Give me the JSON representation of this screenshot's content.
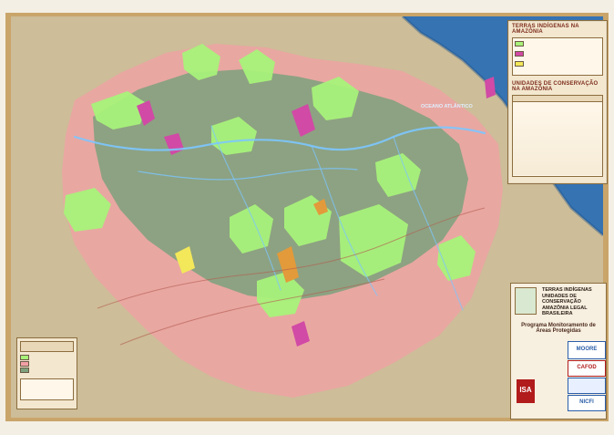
{
  "map": {
    "labels": {
      "ocean": "OCEANO ATLÂNTICO",
      "map_title_lines": [
        "TERRAS INDÍGENAS",
        "UNIDADES DE CONSERVAÇÃO",
        "AMAZÔNIA LEGAL BRASILEIRA"
      ],
      "program_title": "Programa Monitoramento de Áreas Protegidas"
    },
    "tables": {
      "indigenous_title": "TERRAS INDÍGENAS NA AMAZÔNIA",
      "conservation_title": "UNIDADES DE CONSERVAÇÃO NA AMAZÔNIA"
    },
    "logos": {
      "moore": "MOORE",
      "cafod": "CAFOD",
      "nicfi": "NICFI",
      "isa": "ISA"
    },
    "colors": {
      "ocean": "#2d6fb3",
      "indigenous_green": "#a8f27a",
      "conservation_pink": "#f2a0a6",
      "forest": "#7da17c",
      "terrain": "#cdbd98",
      "frame": "#c9a56a",
      "panel": "#f3e7cf",
      "magenta": "#d14aa5",
      "yellow": "#f2e85a",
      "orange": "#e39a3a",
      "rivers": "#7cc6ff",
      "roads": "#b35b4d"
    }
  }
}
